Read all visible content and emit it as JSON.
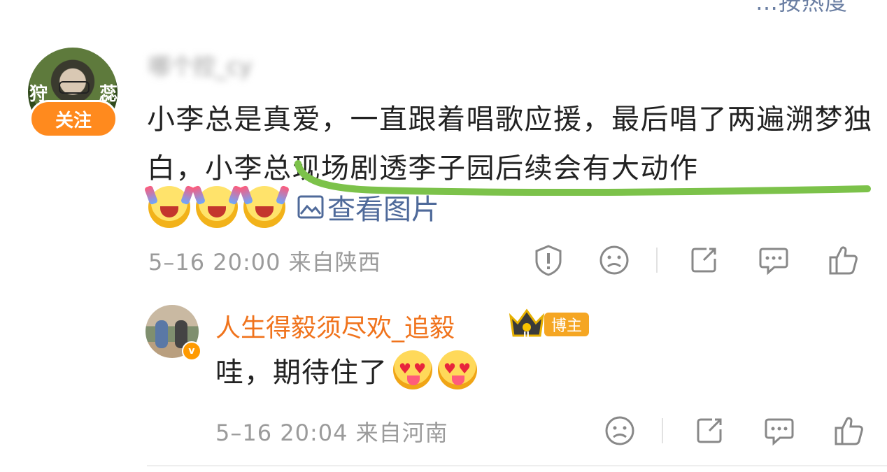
{
  "header": {
    "top_cut_text": "…按热度"
  },
  "comment": {
    "avatar_chars": [
      "狩",
      "蕊"
    ],
    "follow_label": "关注",
    "username": "哪个控_cy",
    "text": "小李总是真爱，一直跟着唱歌应援，最后唱了两遍溯梦独白，小李总现场剧透李子园后续会有大动作",
    "emoji_count": 3,
    "view_pictures_label": "查看图片",
    "meta": "5–16 20:00  来自陕西",
    "underline_color": "#7cc24a"
  },
  "reply": {
    "username": "人生得毅须尽欢_追毅",
    "host_tag": "博主",
    "badge_v": "v",
    "text": "哇，期待住了",
    "meta": "5–16 20:04  来自河南"
  },
  "colors": {
    "follow_button": "#ff8a1e",
    "reply_name": "#f0731c",
    "link": "#4f6a9a",
    "meta": "#9b9b9b"
  },
  "icons": {
    "report": "report-shield-icon",
    "dislike": "frown-face-icon",
    "share": "share-icon",
    "comment": "comment-icon",
    "like": "thumbs-up-icon"
  }
}
